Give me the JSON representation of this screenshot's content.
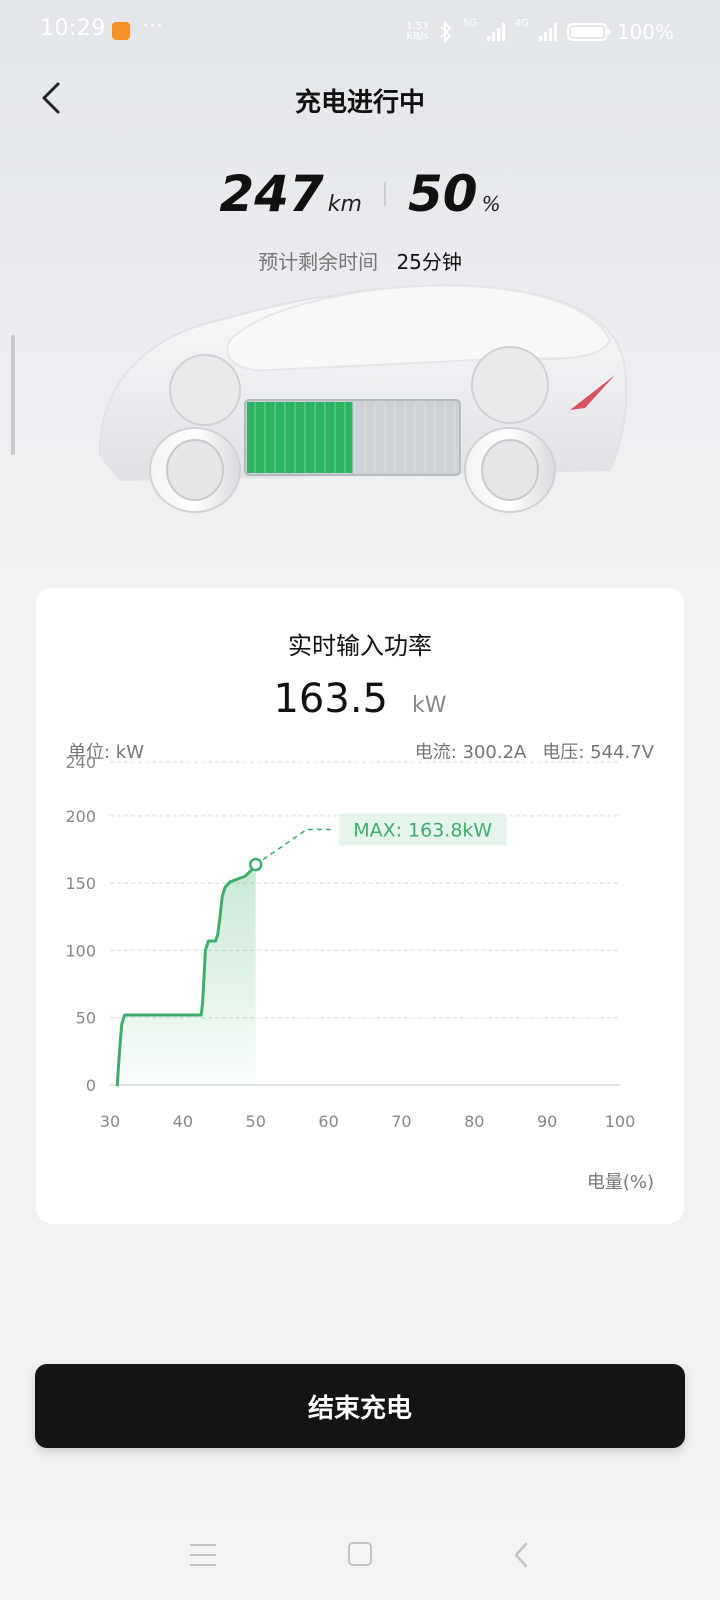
{
  "status_bar": {
    "time": "10:29",
    "more": "···",
    "net_speed_value": "1.53",
    "net_speed_unit": "KB/s",
    "net1": "5G",
    "net2": "4G",
    "battery": "100%"
  },
  "header": {
    "title": "充电进行中"
  },
  "summary": {
    "range_value": "247",
    "range_unit": "km",
    "soc_value": "50",
    "soc_unit": "%",
    "eta_label": "预计剩余时间",
    "eta_value": "25分钟",
    "battery_charge_level": 0.5
  },
  "power_card": {
    "title": "实时输入功率",
    "power_value": "163.5",
    "power_unit": "kW",
    "unit_label": "单位: kW",
    "current_label": "电流: 300.2A",
    "voltage_label": "电压: 544.7V",
    "xlabel": "电量(%)"
  },
  "chart_data": {
    "type": "line",
    "xlabel": "电量(%)",
    "ylabel": "单位: kW",
    "xlim": [
      30,
      100
    ],
    "ylim": [
      0,
      240
    ],
    "x_ticks": [
      "30",
      "40",
      "50",
      "60",
      "70",
      "80",
      "90",
      "100"
    ],
    "y_ticks": [
      "0",
      "50",
      "100",
      "150",
      "200",
      "240"
    ],
    "grid": true,
    "series": [
      {
        "values_x": [
          31,
          31.3,
          31.6,
          32,
          35,
          38,
          42.5,
          42.7,
          42.9,
          43.1,
          43.5,
          44.5,
          44.8,
          45.1,
          45.4,
          45.8,
          46.5,
          47.5,
          48.5,
          49.3,
          50
        ],
        "values_y": [
          0,
          25,
          45,
          52,
          52,
          52,
          52,
          60,
          80,
          100,
          107,
          107,
          112,
          125,
          140,
          147,
          151,
          153,
          155,
          159,
          163.8
        ]
      }
    ],
    "current_point": {
      "x": 50,
      "y": 163.8
    },
    "annotation": "MAX: 163.8kW",
    "colors": {
      "line": "#3fae6c",
      "annotation_text": "#3fae6c",
      "annotation_bg": "#e6f5ec"
    }
  },
  "actions": {
    "end_charge_label": "结束充电"
  },
  "colors": {
    "accent_green": "#3fae6c",
    "button_dark": "#141414",
    "battery_green": "#2fb463"
  }
}
